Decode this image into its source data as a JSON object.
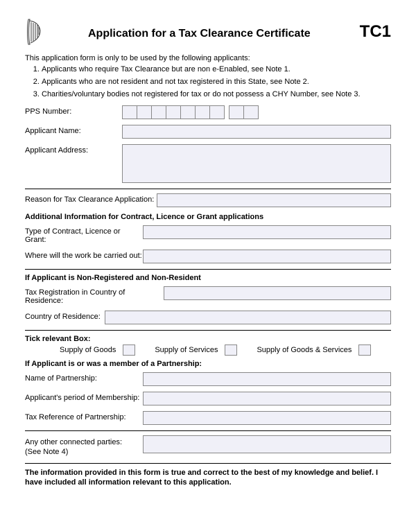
{
  "header": {
    "title": "Application for a Tax Clearance Certificate",
    "doc_code": "TC1"
  },
  "intro": "This application form is only to be used by the following applicants:",
  "notes": [
    "Applicants who require Tax Clearance but are non e-Enabled, see Note 1.",
    "Applicants who are not resident and not tax registered in this State, see Note 2.",
    "Charities/voluntary bodies not registered for tax or do not possess a CHY Number, see Note 3."
  ],
  "labels": {
    "pps": "PPS Number:",
    "name": "Applicant Name:",
    "address": "Applicant Address:",
    "reason": "Reason for Tax Clearance Application:",
    "additional_hdr": "Additional Information for Contract, Licence or Grant applications",
    "contract_type": "Type of Contract, Licence or Grant:",
    "work_where": "Where will the work be carried out:",
    "nonreg_hdr": "If Applicant is Non-Registered and Non-Resident",
    "tax_reg_country": "Tax Registration in Country of Residence:",
    "country_res": "Country of Residence:",
    "tick_hdr": "Tick relevant Box:",
    "supply_goods": "Supply of Goods",
    "supply_services": "Supply of Services",
    "supply_both": "Supply of Goods & Services",
    "partner_hdr": "If Applicant is or was a member of a Partnership:",
    "partner_name": "Name of Partnership:",
    "partner_period": "Applicant's period of Membership:",
    "partner_tax": "Tax Reference of Partnership:",
    "connected_a": "Any other connected parties:",
    "connected_b": "(See Note 4)",
    "declaration": "The information provided in this form is true and correct to the best of my knowledge and belief.  I have included all information relevant to this application."
  }
}
